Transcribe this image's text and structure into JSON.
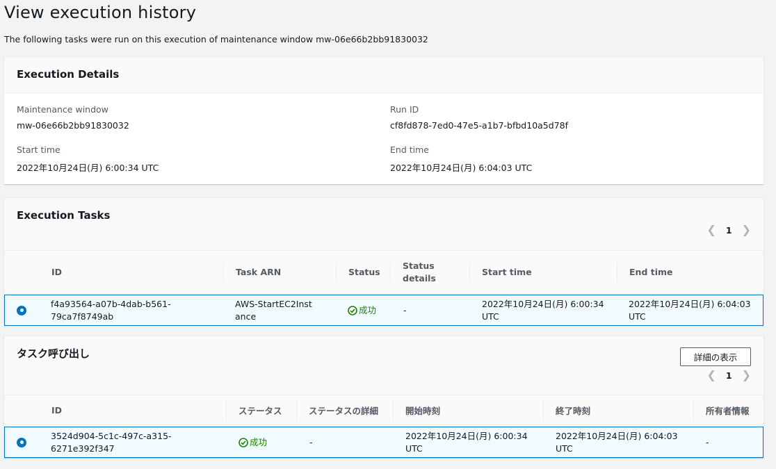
{
  "page": {
    "title": "View execution history",
    "description": "The following tasks were run on this execution of maintenance window mw-06e66b2bb91830032"
  },
  "execution_details": {
    "title": "Execution Details",
    "maintenance_window_label": "Maintenance window",
    "maintenance_window_value": "mw-06e66b2bb91830032",
    "run_id_label": "Run ID",
    "run_id_value": "cf8fd878-7ed0-47e5-a1b7-bfbd10a5d78f",
    "start_time_label": "Start time",
    "start_time_value": "2022年10月24日(月) 6:00:34 UTC",
    "end_time_label": "End time",
    "end_time_value": "2022年10月24日(月) 6:04:03 UTC"
  },
  "execution_tasks": {
    "title": "Execution Tasks",
    "page": "1",
    "columns": [
      "ID",
      "Task ARN",
      "Status",
      "Status details",
      "Start time",
      "End time"
    ],
    "rows": [
      {
        "id": "f4a93564-a07b-4dab-b561-79ca7f8749ab",
        "task_arn": "AWS-StartEC2Instance",
        "status": "成功",
        "status_details": "-",
        "start_time": "2022年10月24日(月) 6:00:34 UTC",
        "end_time": "2022年10月24日(月) 6:04:03 UTC"
      }
    ]
  },
  "task_invocations": {
    "title": "タスク呼び出し",
    "details_button": "詳細の表示",
    "page": "1",
    "columns": [
      "ID",
      "ステータス",
      "ステータスの詳細",
      "開始時刻",
      "終了時刻",
      "所有者情報"
    ],
    "rows": [
      {
        "id": "3524d904-5c1c-497c-a315-6271e392f347",
        "status": "成功",
        "status_details": "-",
        "start_time": "2022年10月24日(月) 6:00:34 UTC",
        "end_time": "2022年10月24日(月) 6:04:03 UTC",
        "owner_info": "-"
      }
    ]
  },
  "colors": {
    "success": "#1d8102",
    "selected_border": "#0073bb",
    "selected_bg": "#f1faff"
  },
  "icons": [
    "chevron-left-icon",
    "chevron-right-icon",
    "status-success-icon",
    "radio-selected-icon"
  ]
}
